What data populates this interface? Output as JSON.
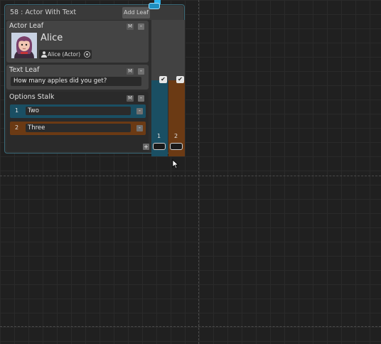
{
  "node": {
    "title": "58 : Actor With Text",
    "add_leaf_label": "Add Leaf",
    "actor_leaf": {
      "label": "Actor Leaf",
      "m_label": "M",
      "minus_label": "-",
      "name": "Alice",
      "actor_field": "Alice (Actor)"
    },
    "text_leaf": {
      "label": "Text Leaf",
      "m_label": "M",
      "minus_label": "-",
      "text": "How many apples did you get?"
    },
    "options_stalk": {
      "label": "Options Stalk",
      "m_label": "M",
      "minus_label": "-",
      "add_label": "+",
      "options": [
        {
          "number": "1",
          "value": "Two",
          "minus_label": "-",
          "color": "#1a4f63"
        },
        {
          "number": "2",
          "value": "Three",
          "minus_label": "-",
          "color": "#6b3a14"
        }
      ]
    },
    "ports": [
      {
        "label": "1",
        "check": "✔",
        "color": "#1a4f63"
      },
      {
        "label": "2",
        "check": "✔",
        "color": "#6b3a14"
      }
    ]
  },
  "colors": {
    "accent": "#2eb4ee",
    "option1": "#1a4f63",
    "option2": "#6b3a14",
    "node_border": "#3b6a78"
  }
}
